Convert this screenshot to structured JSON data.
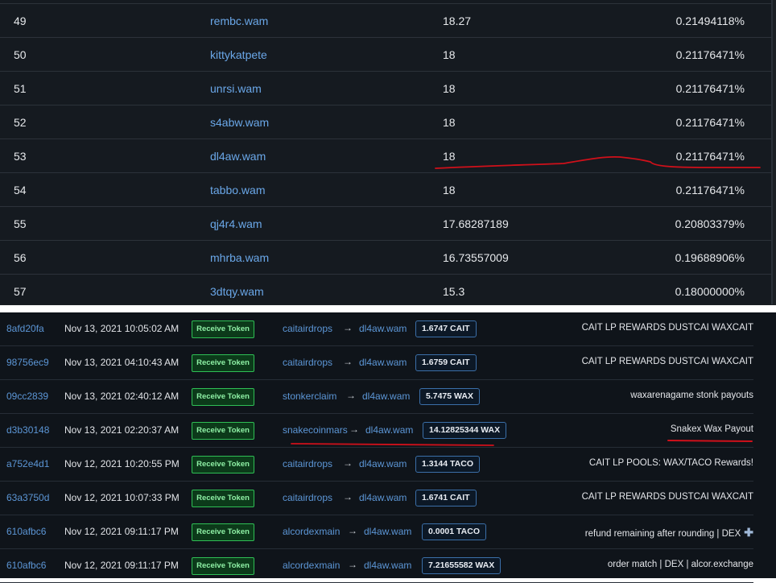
{
  "holders": [
    {
      "rank": "49",
      "account": "rembc.wam",
      "amount": "18.27",
      "percent": "0.21494118%"
    },
    {
      "rank": "50",
      "account": "kittykatpete",
      "amount": "18",
      "percent": "0.21176471%"
    },
    {
      "rank": "51",
      "account": "unrsi.wam",
      "amount": "18",
      "percent": "0.21176471%"
    },
    {
      "rank": "52",
      "account": "s4abw.wam",
      "amount": "18",
      "percent": "0.21176471%"
    },
    {
      "rank": "53",
      "account": "dl4aw.wam",
      "amount": "18",
      "percent": "0.21176471%"
    },
    {
      "rank": "54",
      "account": "tabbo.wam",
      "amount": "18",
      "percent": "0.21176471%"
    },
    {
      "rank": "55",
      "account": "qj4r4.wam",
      "amount": "17.68287189",
      "percent": "0.20803379%"
    },
    {
      "rank": "56",
      "account": "mhrba.wam",
      "amount": "16.73557009",
      "percent": "0.19688906%"
    },
    {
      "rank": "57",
      "account": "3dtqy.wam",
      "amount": "15.3",
      "percent": "0.18000000%"
    }
  ],
  "transactions": [
    {
      "hash": "8afd20fa",
      "date": "Nov 13, 2021 10:05:02 AM",
      "action": "Receive Token",
      "from": "caitairdrops",
      "to": "dl4aw.wam",
      "amount": "1.6747 CAIT",
      "memo": "CAIT LP REWARDS DUSTCAI WAXCAIT"
    },
    {
      "hash": "98756ec9",
      "date": "Nov 13, 2021 04:10:43 AM",
      "action": "Receive Token",
      "from": "caitairdrops",
      "to": "dl4aw.wam",
      "amount": "1.6759 CAIT",
      "memo": "CAIT LP REWARDS DUSTCAI WAXCAIT"
    },
    {
      "hash": "09cc2839",
      "date": "Nov 13, 2021 02:40:12 AM",
      "action": "Receive Token",
      "from": "stonkerclaim",
      "to": "dl4aw.wam",
      "amount": "5.7475 WAX",
      "memo": "waxarenagame stonk payouts"
    },
    {
      "hash": "d3b30148",
      "date": "Nov 13, 2021 02:20:37 AM",
      "action": "Receive Token",
      "from": "snakecoinmars",
      "to": "dl4aw.wam",
      "amount": "14.12825344 WAX",
      "memo": "Snakex Wax Payout"
    },
    {
      "hash": "a752e4d1",
      "date": "Nov 12, 2021 10:20:55 PM",
      "action": "Receive Token",
      "from": "caitairdrops",
      "to": "dl4aw.wam",
      "amount": "1.3144 TACO",
      "memo": "CAIT LP POOLS: WAX/TACO Rewards!"
    },
    {
      "hash": "63a3750d",
      "date": "Nov 12, 2021 10:07:33 PM",
      "action": "Receive Token",
      "from": "caitairdrops",
      "to": "dl4aw.wam",
      "amount": "1.6741 CAIT",
      "memo": "CAIT LP REWARDS DUSTCAI WAXCAIT"
    },
    {
      "hash": "610afbc6",
      "date": "Nov 12, 2021 09:11:17 PM",
      "action": "Receive Token",
      "from": "alcordexmain",
      "to": "dl4aw.wam",
      "amount": "0.0001 TACO",
      "memo": "refund remaining after rounding | DEX"
    },
    {
      "hash": "610afbc6",
      "date": "Nov 12, 2021 09:11:17 PM",
      "action": "Receive Token",
      "from": "alcordexmain",
      "to": "dl4aw.wam",
      "amount": "7.21655582 WAX",
      "memo": "order match | DEX | alcor.exchange"
    }
  ],
  "icons": {
    "transfer_arrow": "arrow-right-icon",
    "memo_plus": "plus-icon"
  },
  "colors": {
    "link": "#5c96d6",
    "badge_green": "#2fbf55",
    "annotation_red": "#d0101a"
  }
}
